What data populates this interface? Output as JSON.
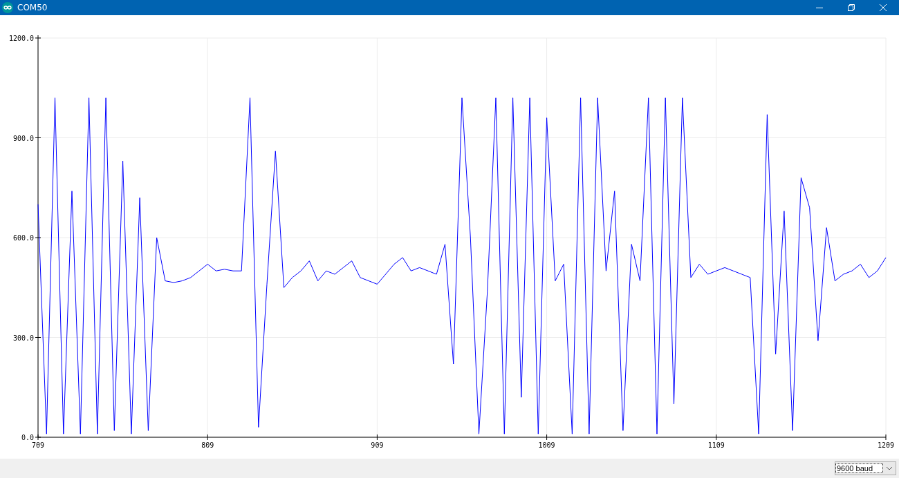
{
  "window": {
    "title": "COM50"
  },
  "plot": {
    "chart_data": {
      "type": "line",
      "grid": true,
      "xlim": [
        709,
        1209
      ],
      "ylim": [
        0,
        1200
      ],
      "xticks": [
        {
          "value": 709,
          "label": "709"
        },
        {
          "value": 809,
          "label": "809"
        },
        {
          "value": 909,
          "label": "909"
        },
        {
          "value": 1009,
          "label": "1009"
        },
        {
          "value": 1109,
          "label": "1109"
        },
        {
          "value": 1209,
          "label": "1209"
        }
      ],
      "yticks": [
        {
          "value": 0,
          "label": "0.0"
        },
        {
          "value": 300,
          "label": "300.0"
        },
        {
          "value": 600,
          "label": "600.0"
        },
        {
          "value": 900,
          "label": "900.0"
        },
        {
          "value": 1200,
          "label": "1200.0"
        }
      ],
      "x": [
        709,
        714,
        719,
        724,
        729,
        734,
        739,
        744,
        749,
        754,
        759,
        764,
        769,
        774,
        779,
        784,
        789,
        794,
        799,
        804,
        809,
        814,
        819,
        824,
        829,
        834,
        839,
        844,
        849,
        854,
        859,
        864,
        869,
        874,
        879,
        884,
        889,
        894,
        899,
        904,
        909,
        914,
        919,
        924,
        929,
        934,
        939,
        944,
        949,
        954,
        959,
        964,
        969,
        974,
        979,
        984,
        989,
        994,
        999,
        1004,
        1009,
        1014,
        1019,
        1024,
        1029,
        1034,
        1039,
        1044,
        1049,
        1054,
        1059,
        1064,
        1069,
        1074,
        1079,
        1084,
        1089,
        1094,
        1099,
        1104,
        1109,
        1114,
        1119,
        1124,
        1129,
        1134,
        1139,
        1144,
        1149,
        1154,
        1159,
        1164,
        1169,
        1174,
        1179,
        1184,
        1189,
        1194,
        1199,
        1204,
        1209
      ],
      "series": [
        {
          "color": "#0000ff",
          "values": [
            700,
            10,
            1020,
            10,
            740,
            10,
            1020,
            10,
            1020,
            20,
            830,
            10,
            720,
            20,
            600,
            470,
            465,
            470,
            480,
            500,
            520,
            500,
            505,
            500,
            500,
            1020,
            30,
            460,
            860,
            450,
            480,
            500,
            530,
            470,
            500,
            490,
            510,
            530,
            480,
            470,
            460,
            490,
            520,
            540,
            500,
            510,
            500,
            490,
            580,
            220,
            1020,
            600,
            10,
            440,
            1020,
            10,
            1020,
            120,
            1020,
            10,
            960,
            470,
            520,
            10,
            1020,
            10,
            1020,
            500,
            740,
            20,
            580,
            470,
            1020,
            10,
            1020,
            100,
            1020,
            480,
            520,
            490,
            500,
            510,
            500,
            490,
            480,
            10,
            970,
            250,
            680,
            20,
            780,
            690,
            290,
            630,
            470,
            490,
            500,
            520,
            480,
            500,
            540
          ]
        }
      ]
    }
  },
  "baud_select": {
    "value": "9600 baud"
  }
}
